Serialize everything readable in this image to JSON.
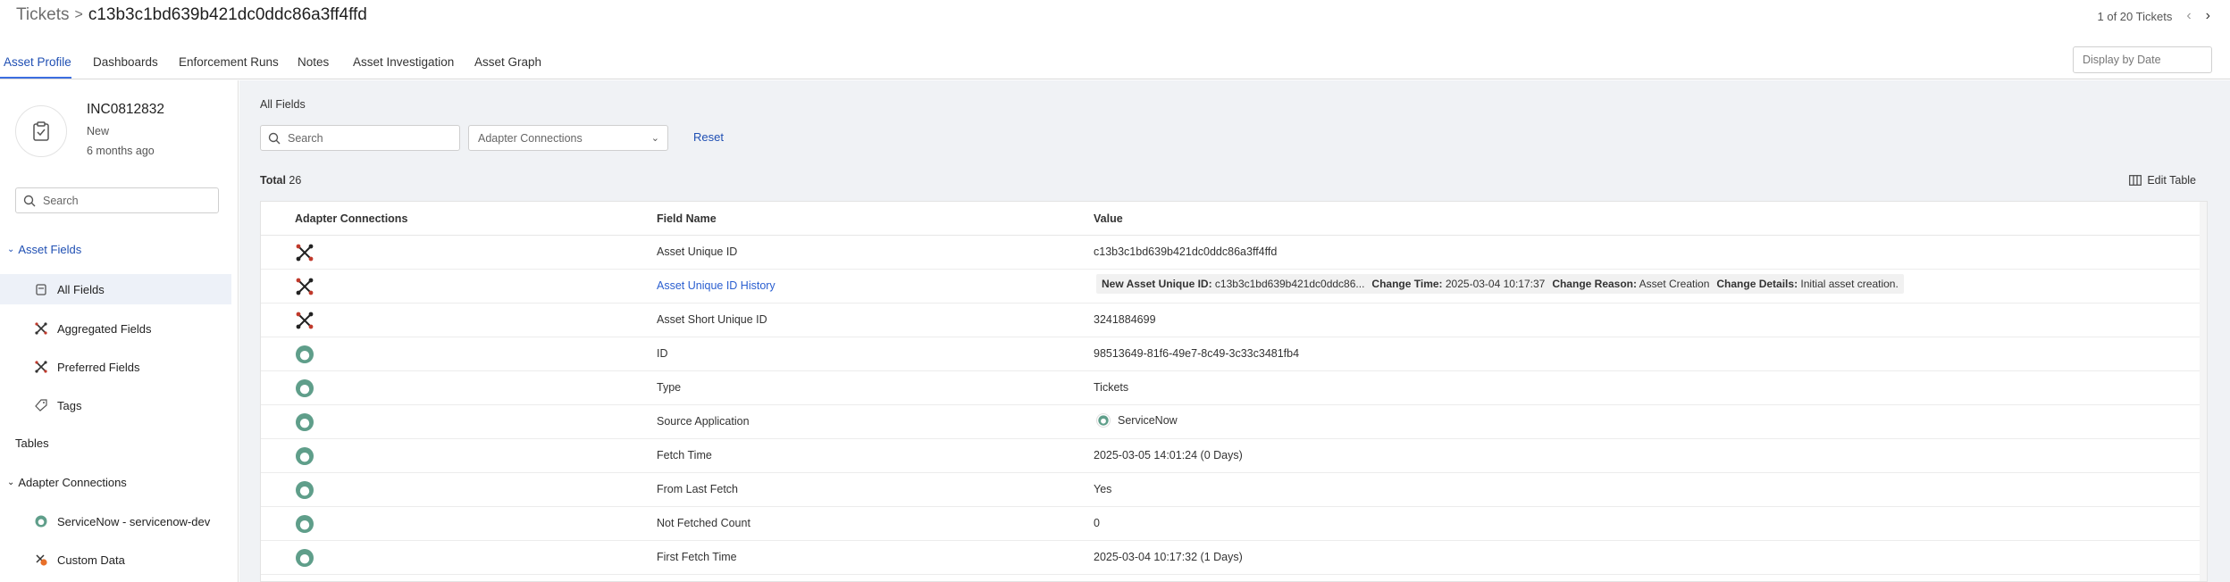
{
  "header": {
    "breadcrumb_root": "Tickets",
    "breadcrumb_sep": ">",
    "breadcrumb_current": "c13b3c1bd639b421dc0ddc86a3ff4ffd",
    "pager_text": "1 of 20 Tickets"
  },
  "tabs": [
    {
      "label": "Asset Profile"
    },
    {
      "label": "Dashboards"
    },
    {
      "label": "Enforcement Runs"
    },
    {
      "label": "Notes"
    },
    {
      "label": "Asset Investigation"
    },
    {
      "label": "Asset Graph"
    }
  ],
  "display_by_placeholder": "Display by Date",
  "sidebar": {
    "asset_id": "INC0812832",
    "asset_status": "New",
    "asset_time": "6 months ago",
    "search_placeholder": "Search",
    "asset_fields_label": "Asset Fields",
    "items": [
      {
        "label": "All Fields",
        "icon": "clipboard-icon"
      },
      {
        "label": "Aggregated Fields",
        "icon": "aggregate-icon"
      },
      {
        "label": "Preferred Fields",
        "icon": "aggregate-icon"
      },
      {
        "label": "Tags",
        "icon": "tag-icon"
      }
    ],
    "tables_label": "Tables",
    "adapter_connections_label": "Adapter Connections",
    "adapters": [
      {
        "label": "ServiceNow - servicenow-dev",
        "icon": "servicenow-icon"
      },
      {
        "label": "Custom Data",
        "icon": "custom-data-icon"
      }
    ]
  },
  "main": {
    "title": "All Fields",
    "search_placeholder": "Search",
    "connections_select": "Adapter Connections",
    "reset_label": "Reset",
    "total_label": "Total",
    "total_count": "26",
    "edit_table_label": "Edit Table",
    "columns": [
      "Adapter Connections",
      "Field Name",
      "Value"
    ],
    "rows": [
      {
        "icon": "aggregate-icon",
        "field": "Asset Unique ID",
        "value": "c13b3c1bd639b421dc0ddc86a3ff4ffd"
      },
      {
        "icon": "aggregate-icon",
        "field": "Asset Unique ID History",
        "value": "",
        "link": true
      },
      {
        "icon": "aggregate-icon",
        "field": "Asset Short Unique ID",
        "value": "3241884699"
      },
      {
        "icon": "servicenow-icon",
        "field": "ID",
        "value": "98513649-81f6-49e7-8c49-3c33c3481fb4"
      },
      {
        "icon": "servicenow-icon",
        "field": "Type",
        "value": "Tickets"
      },
      {
        "icon": "servicenow-icon",
        "field": "Source Application",
        "value": "ServiceNow",
        "value_icon": "servicenow-icon"
      },
      {
        "icon": "servicenow-icon",
        "field": "Fetch Time",
        "value": "2025-03-05 14:01:24 (0 Days)"
      },
      {
        "icon": "servicenow-icon",
        "field": "From Last Fetch",
        "value": "Yes"
      },
      {
        "icon": "servicenow-icon",
        "field": "Not Fetched Count",
        "value": "0"
      },
      {
        "icon": "servicenow-icon",
        "field": "First Fetch Time",
        "value": "2025-03-04 10:17:32 (1 Days)"
      }
    ],
    "history_chip": {
      "k1": "New Asset Unique ID:",
      "v1": "c13b3c1bd639b421dc0ddc86...",
      "k2": "Change Time:",
      "v2": "2025-03-04 10:17:37",
      "k3": "Change Reason:",
      "v3": "Asset Creation",
      "k4": "Change Details:",
      "v4": "Initial asset creation."
    }
  },
  "colors": {
    "accent": "#1f4fb3",
    "link": "#2b5fd0",
    "servicenow_green": "#5f9e8a",
    "custom_orange": "#e8702a"
  }
}
